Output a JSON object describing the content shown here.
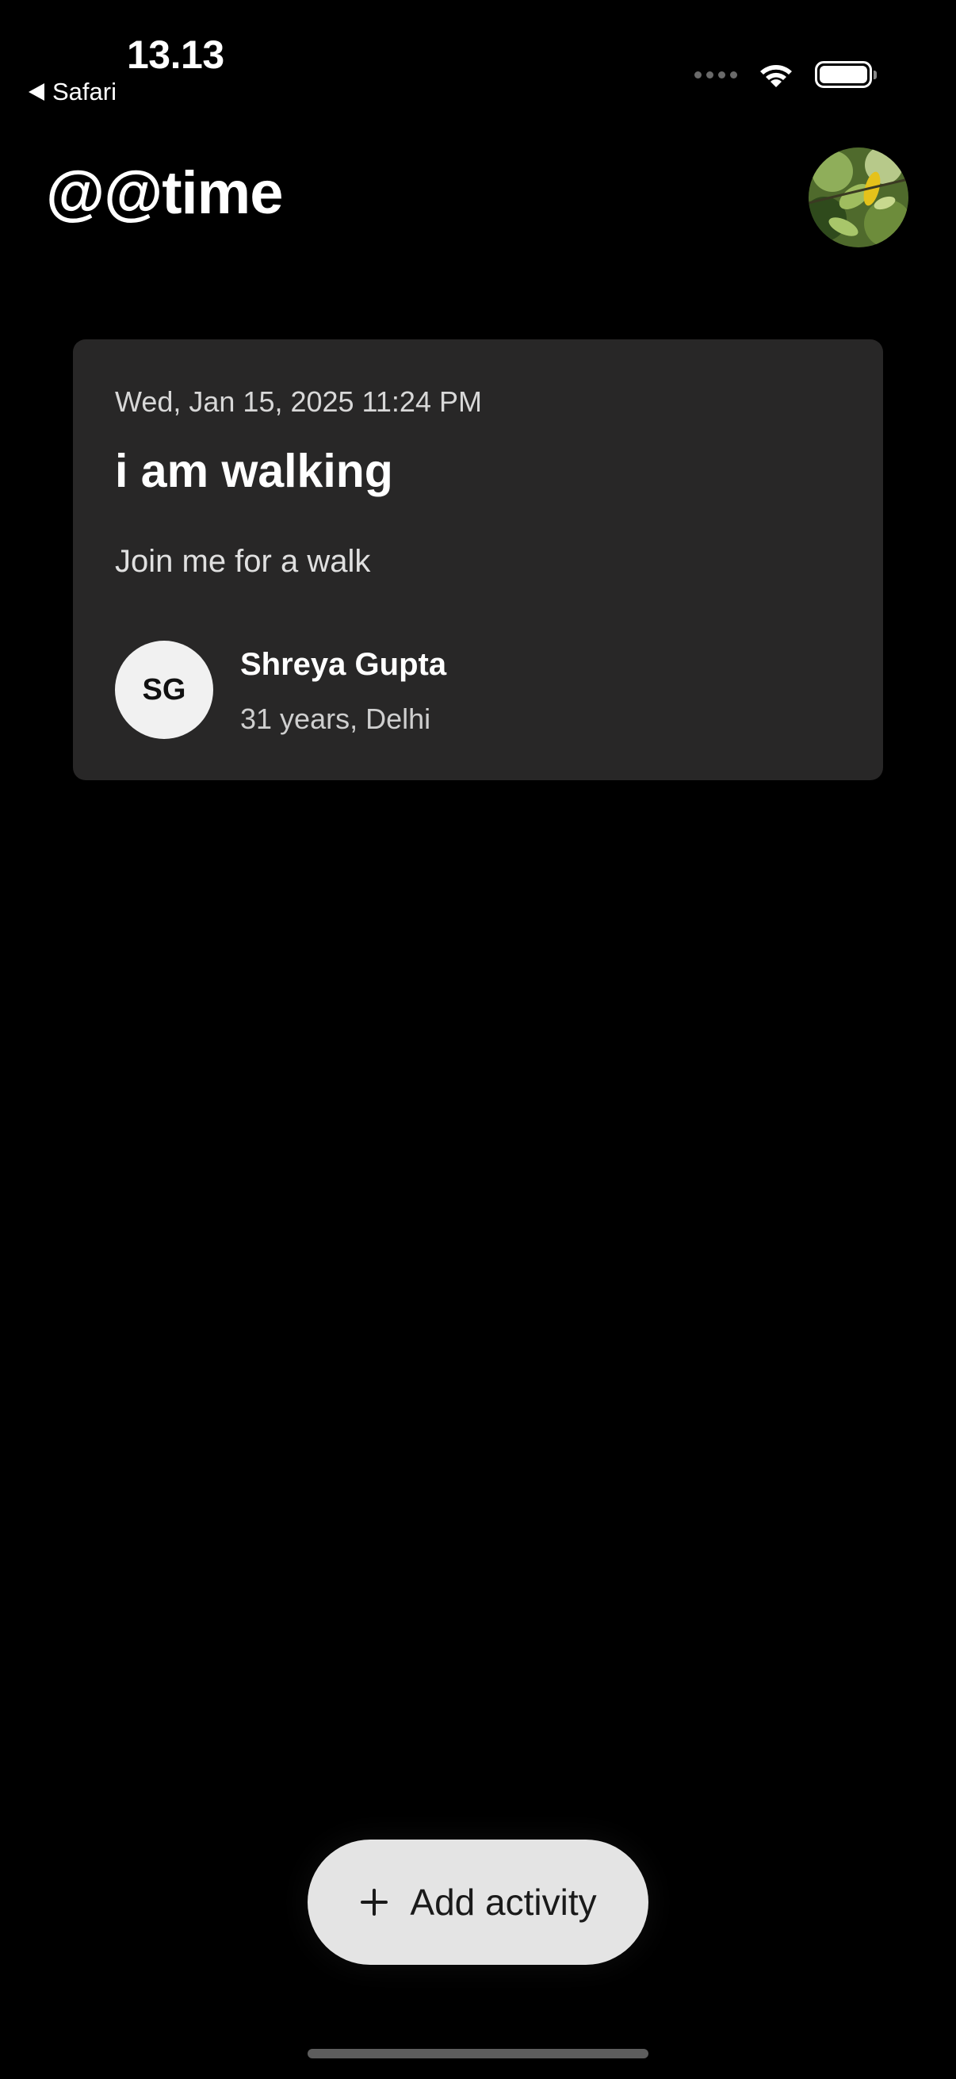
{
  "status_bar": {
    "time": "13.13",
    "back_app": "Safari",
    "icons": [
      "signal-dots-icon",
      "wifi-icon",
      "battery-icon"
    ]
  },
  "header": {
    "title": "@@time",
    "avatar": "profile-photo-leaves"
  },
  "activities": [
    {
      "date": "Wed, Jan 15, 2025 11:24 PM",
      "title": "i am walking",
      "description": "Join me for a walk",
      "host": {
        "initials": "SG",
        "name": "Shreya Gupta",
        "meta": "31 years, Delhi"
      }
    }
  ],
  "fab": {
    "label": "Add activity",
    "icon": "plus-icon"
  },
  "colors": {
    "background": "#000000",
    "card": "#282727",
    "fab": "#e4e4e4",
    "host_avatar": "#f1f1f1"
  }
}
